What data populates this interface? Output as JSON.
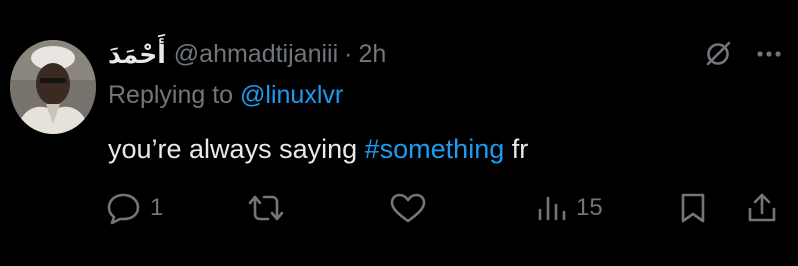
{
  "tweet": {
    "display_name": "أَحْمَدَ",
    "handle": "@ahmadtijaniii",
    "separator": "·",
    "time": "2h",
    "replying_prefix": "Replying to",
    "replying_to": "@linuxlvr",
    "text_before": "you’re always saying",
    "hashtag": "#something",
    "text_after": "fr",
    "avatar_icon": "avatar-photo"
  },
  "actions": {
    "reply_count": "1",
    "views_count": "15"
  },
  "icons": {
    "grok": "grok-icon",
    "more": "more-icon",
    "reply": "reply-icon",
    "retweet": "retweet-icon",
    "like": "like-icon",
    "views": "views-icon",
    "bookmark": "bookmark-icon",
    "share": "share-icon"
  },
  "colors": {
    "background": "#000000",
    "text": "#e7e9ea",
    "muted": "#71767b",
    "accent": "#1d9bf0"
  }
}
